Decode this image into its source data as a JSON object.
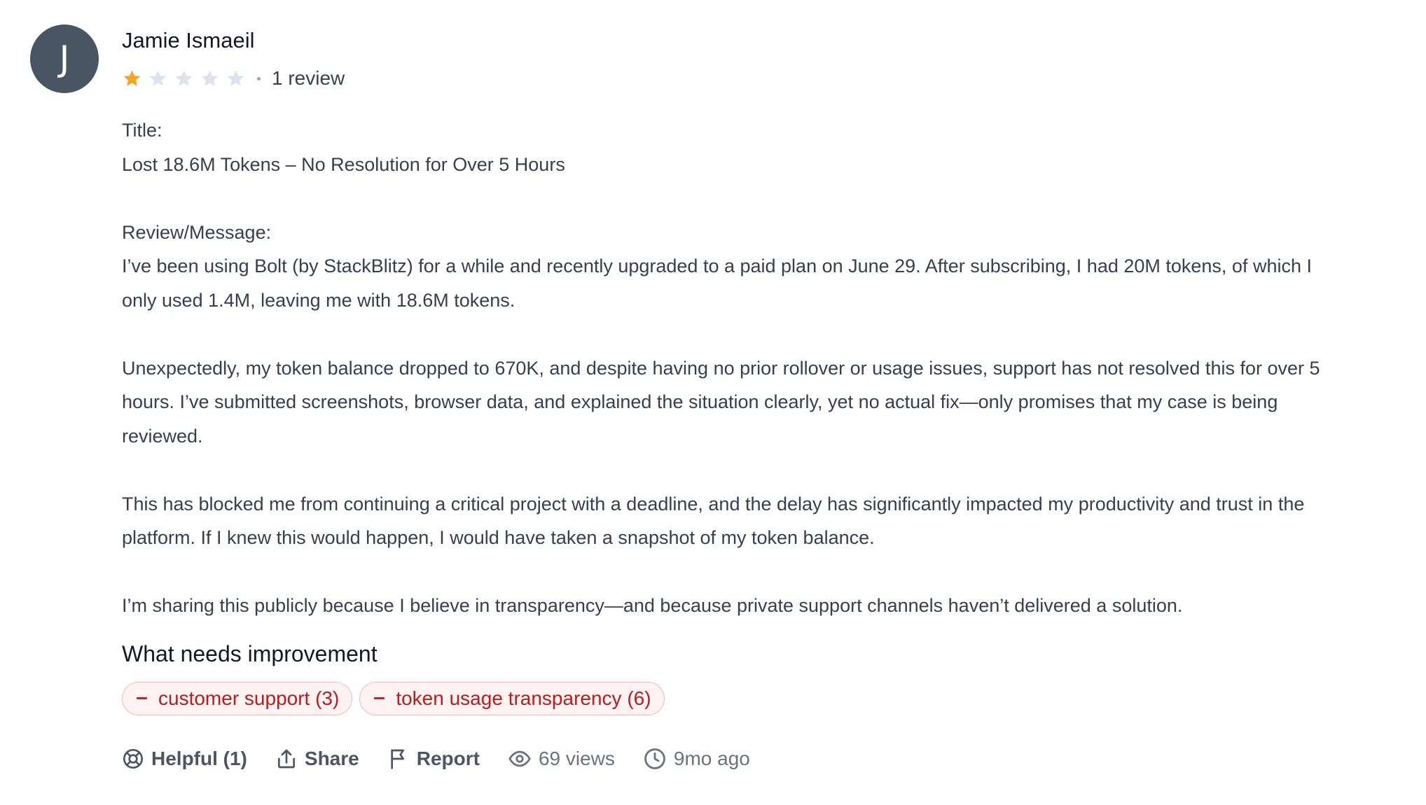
{
  "author": {
    "initial": "J",
    "name": "Jamie Ismaeil",
    "avatar_color": "#475662"
  },
  "rating": {
    "stars": 1,
    "max_stars": 5,
    "filled_color": "#f5a623",
    "empty_color": "#dde3ea",
    "review_count_text": "1 review"
  },
  "body": {
    "title_label": "Title:",
    "title_text": "Lost 18.6M Tokens – No Resolution for Over 5 Hours",
    "message_label": "Review/Message:",
    "paragraphs": [
      "I’ve been using Bolt (by StackBlitz) for a while and recently upgraded to a paid plan on June 29. After subscribing, I had 20M tokens, of which I only used 1.4M, leaving me with 18.6M tokens.",
      "Unexpectedly, my token balance dropped to 670K, and despite having no prior rollover or usage issues, support has not resolved this for over 5 hours. I’ve submitted screenshots, browser data, and explained the situation clearly, yet no actual fix—only promises that my case is being reviewed.",
      "This has blocked me from continuing a critical project with a deadline, and the delay has significantly impacted my productivity and trust in the platform. If I knew this would happen, I would have taken a snapshot of my token balance.",
      "I’m sharing this publicly because I believe in transparency—and because private support channels haven’t delivered a solution."
    ]
  },
  "improvement": {
    "heading": "What needs improvement",
    "tags": [
      {
        "label": "customer support (3)"
      },
      {
        "label": "token usage transparency (6)"
      }
    ],
    "tag_color": "#b91c1c"
  },
  "actions": {
    "helpful_label": "Helpful (1)",
    "share_label": "Share",
    "report_label": "Report",
    "views_label": "69 views",
    "time_label": "9mo ago"
  }
}
